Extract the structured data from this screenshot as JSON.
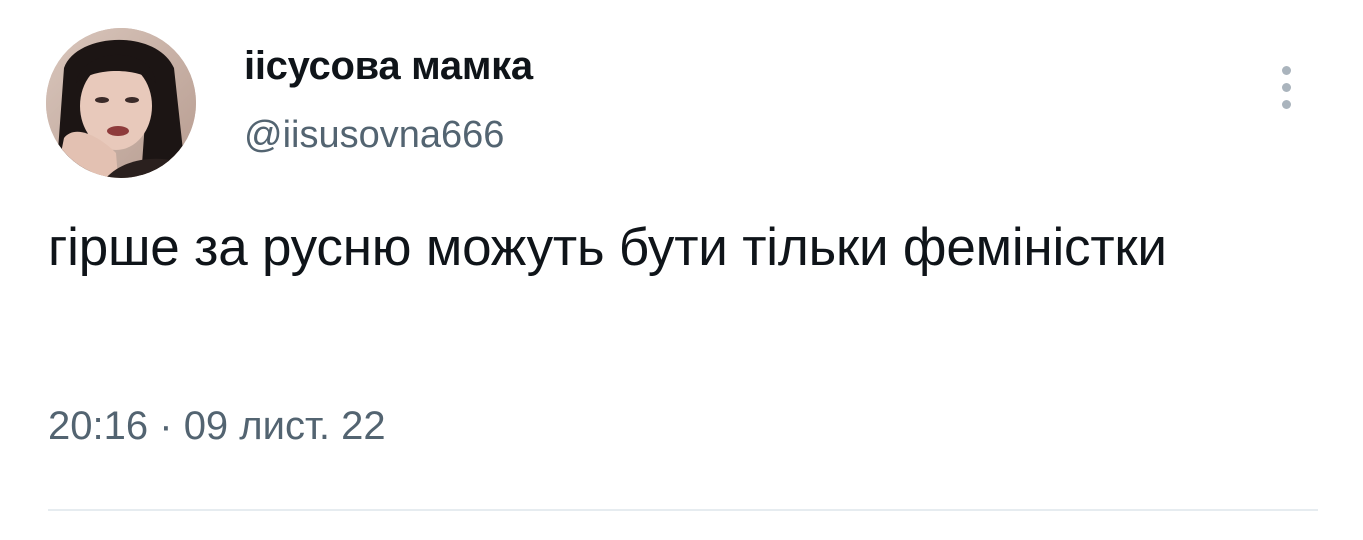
{
  "author": {
    "display_name": "іісусова мамка",
    "handle": "@iisusovna666",
    "avatar_icon": "profile-photo"
  },
  "tweet": {
    "text": "гірше за русню можуть бути тільки феміністки",
    "time": "20:16",
    "separator": "·",
    "date": "09 лист. 22"
  },
  "actions": {
    "more_icon": "vertical-ellipsis-icon"
  },
  "colors": {
    "primary_text": "#0f1419",
    "secondary_text": "#536471",
    "divider": "#e6ecf0",
    "more_dots": "#aab4bd"
  }
}
